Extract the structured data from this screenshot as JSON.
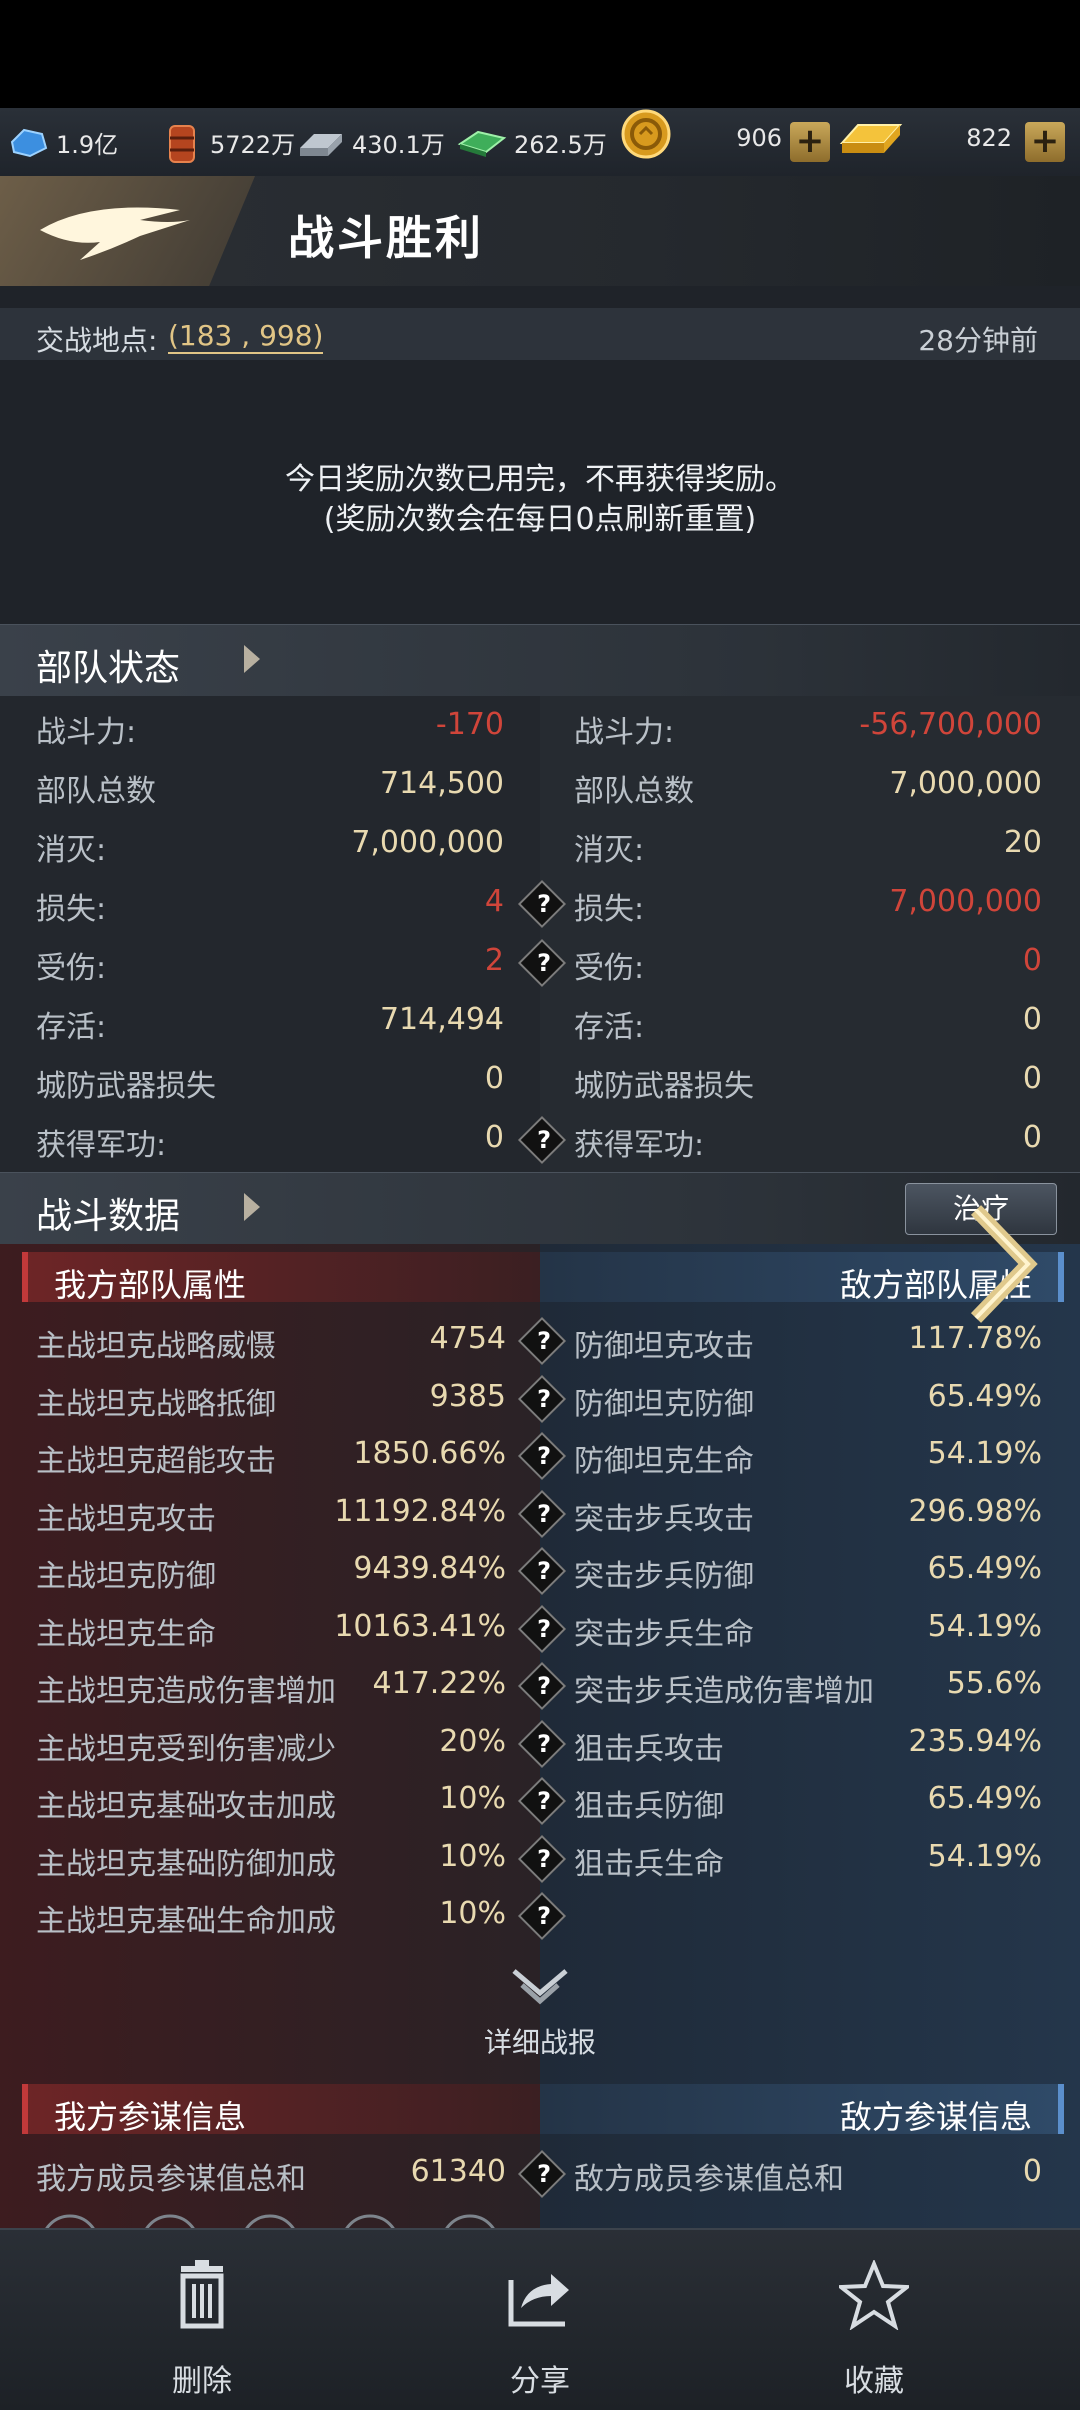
{
  "resources": {
    "crystal": "1.9亿",
    "oil": "5722万",
    "steel": "430.1万",
    "cash": "262.5万",
    "coin": "906",
    "gold": "822"
  },
  "header": {
    "title": "战斗胜利",
    "location_label": "交战地点:",
    "location_value": "(183 , 998)",
    "time_ago": "28分钟前"
  },
  "notice": {
    "line1": "今日奖励次数已用完，不再获得奖励。",
    "line2": "(奖励次数会在每日0点刷新重置)"
  },
  "troop_status": {
    "title": "部队状态",
    "rows": [
      {
        "label": "战斗力:",
        "my": "-170",
        "enemy_label": "战斗力:",
        "enemy": "-56,700,000"
      },
      {
        "label": "部队总数",
        "my": "714,500",
        "enemy_label": "部队总数",
        "enemy": "7,000,000"
      },
      {
        "label": "消灭:",
        "my": "7,000,000",
        "enemy_label": "消灭:",
        "enemy": "20"
      },
      {
        "label": "损失:",
        "my": "4",
        "enemy_label": "损失:",
        "enemy": "7,000,000"
      },
      {
        "label": "受伤:",
        "my": "2",
        "enemy_label": "受伤:",
        "enemy": "0"
      },
      {
        "label": "存活:",
        "my": "714,494",
        "enemy_label": "存活:",
        "enemy": "0"
      },
      {
        "label": "城防武器损失",
        "my": "0",
        "enemy_label": "城防武器损失",
        "enemy": "0"
      },
      {
        "label": "获得军功:",
        "my": "0",
        "enemy_label": "获得军功:",
        "enemy": "0"
      }
    ]
  },
  "battle_data": {
    "title": "战斗数据",
    "govern_button": "治疗",
    "my_header": "我方部队属性",
    "enemy_header": "敌方部队属性",
    "my_rows": [
      {
        "label": "主战坦克战略威慑",
        "value": "4754"
      },
      {
        "label": "主战坦克战略抵御",
        "value": "9385"
      },
      {
        "label": "主战坦克超能攻击",
        "value": "1850.66%"
      },
      {
        "label": "主战坦克攻击",
        "value": "11192.84%"
      },
      {
        "label": "主战坦克防御",
        "value": "9439.84%"
      },
      {
        "label": "主战坦克生命",
        "value": "10163.41%"
      },
      {
        "label": "主战坦克造成伤害增加",
        "value": "417.22%"
      },
      {
        "label": "主战坦克受到伤害减少",
        "value": "20%"
      },
      {
        "label": "主战坦克基础攻击加成",
        "value": "10%"
      },
      {
        "label": "主战坦克基础防御加成",
        "value": "10%"
      },
      {
        "label": "主战坦克基础生命加成",
        "value": "10%"
      }
    ],
    "enemy_rows": [
      {
        "label": "防御坦克攻击",
        "value": "117.78%"
      },
      {
        "label": "防御坦克防御",
        "value": "65.49%"
      },
      {
        "label": "防御坦克生命",
        "value": "54.19%"
      },
      {
        "label": "突击步兵攻击",
        "value": "296.98%"
      },
      {
        "label": "突击步兵防御",
        "value": "65.49%"
      },
      {
        "label": "突击步兵生命",
        "value": "54.19%"
      },
      {
        "label": "突击步兵造成伤害增加",
        "value": "55.6%"
      },
      {
        "label": "狙击兵攻击",
        "value": "235.94%"
      },
      {
        "label": "狙击兵防御",
        "value": "65.49%"
      },
      {
        "label": "狙击兵生命",
        "value": "54.19%"
      }
    ],
    "detail_label": "详细战报"
  },
  "advisors": {
    "my_header": "我方参谋信息",
    "enemy_header": "敌方参谋信息",
    "my_label": "我方成员参谋值总和",
    "my_value": "61340",
    "enemy_label": "敌方成员参谋值总和",
    "enemy_value": "0"
  },
  "bottom_nav": {
    "delete": "删除",
    "share": "分享",
    "favorite": "收藏"
  }
}
